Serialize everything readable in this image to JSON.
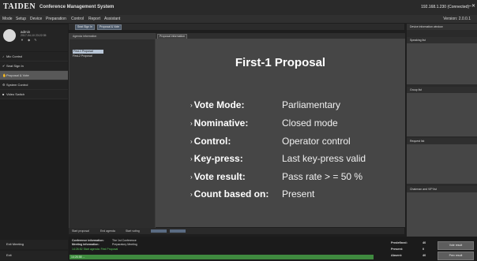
{
  "app": {
    "brand": "TAIDEN",
    "title": "Conference Management System",
    "connection": "192.168.1.230  (Connected)"
  },
  "menu": {
    "items": [
      "Mode",
      "Setup",
      "Device",
      "Preparation",
      "Control",
      "Report",
      "Assistant"
    ],
    "version": "Version: 2.0.0.1"
  },
  "top_tabs": [
    "Seat Sign In",
    "Proposal & Vote"
  ],
  "user": {
    "name": "admin",
    "date": "2017-04-10 23:22:35"
  },
  "nav": {
    "items": [
      {
        "label": "Mic Control"
      },
      {
        "label": "Seat Sign In"
      },
      {
        "label": "Proposal & Vote"
      },
      {
        "label": "System Control"
      },
      {
        "label": "Video Switch"
      }
    ],
    "exit_meeting": "Exit Meeting",
    "exit": "Exit"
  },
  "agenda": {
    "header": "Agenda information",
    "items": [
      "First-1 Proposal",
      "First-2 Proposal"
    ]
  },
  "proposal_tab": "Proposal information",
  "proposal": {
    "title": "First-1 Proposal",
    "rows": [
      {
        "label": "Vote Mode:",
        "value": "Parliamentary"
      },
      {
        "label": "Nominative:",
        "value": "Closed mode"
      },
      {
        "label": "Control:",
        "value": "Operator control"
      },
      {
        "label": "Key-press:",
        "value": "Last key-press valid"
      },
      {
        "label": "Vote result:",
        "value": "Pass rate > = 50    %"
      },
      {
        "label": "Count based on:",
        "value": "Present"
      }
    ]
  },
  "bottom_toolbar": [
    "Start proposal",
    "End agenda",
    "Start voting"
  ],
  "right_panel": {
    "header": "Device information window",
    "sections": [
      "Speaking list",
      "Group list",
      "Request list",
      "Chairman and VIP list"
    ]
  },
  "status": {
    "conference_label": "Conference information:",
    "conference_value": "The 1st Conference",
    "meeting_label": "Meeting information:",
    "meeting_value": "Preparatory Meeting",
    "log1": "14:26:52  Start agenda: First Proposal",
    "log2": "14:26:58  ...",
    "predefined_label": "Predefined:",
    "predefined_value": "40",
    "present_label": "Present:",
    "present_value": "0",
    "absent_label": "Absent:",
    "absent_value": "40",
    "btn_results": "Vote result",
    "btn_prev": "Prev result"
  },
  "colors": {
    "accent": "#3f8a3f",
    "active_nav": "#585858",
    "proposal_bg": "#464646"
  }
}
